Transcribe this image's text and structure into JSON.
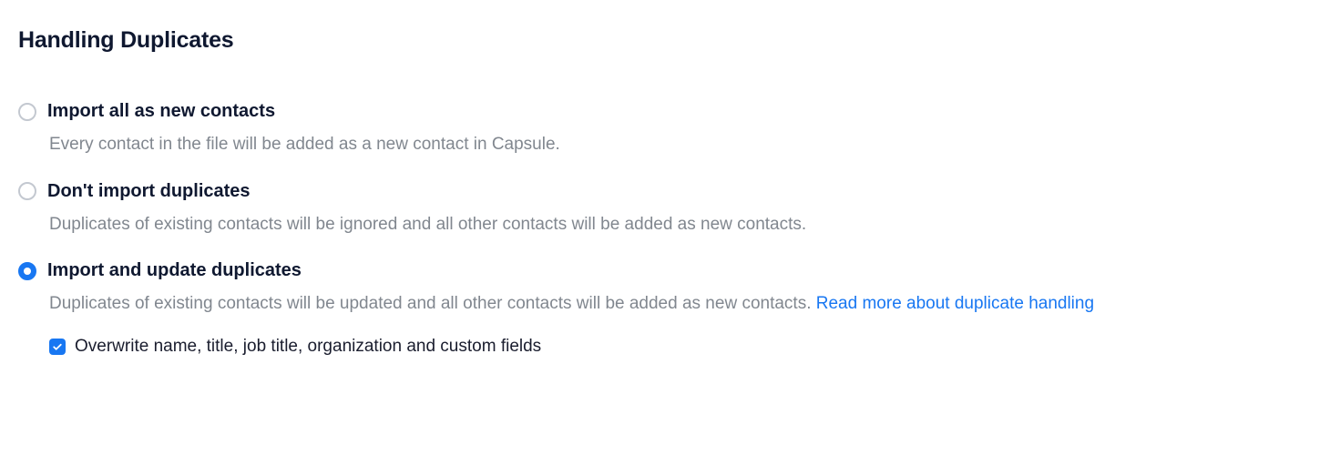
{
  "section": {
    "heading": "Handling Duplicates"
  },
  "options": [
    {
      "title": "Import all as new contacts",
      "description": "Every contact in the file will be added as a new contact in Capsule.",
      "selected": false
    },
    {
      "title": "Don't import duplicates",
      "description": "Duplicates of existing contacts will be ignored and all other contacts will be added as new contacts.",
      "selected": false
    },
    {
      "title": "Import and update duplicates",
      "description": "Duplicates of existing contacts will be updated and all other contacts will be added as new contacts. ",
      "link_text": "Read more about duplicate handling",
      "selected": true,
      "sub_option": {
        "label": "Overwrite name, title, job title, organization and custom fields",
        "checked": true
      }
    }
  ]
}
